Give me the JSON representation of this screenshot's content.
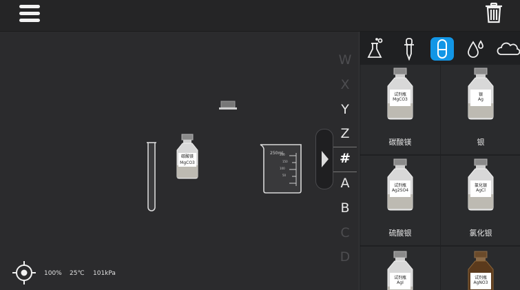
{
  "toolbar": {
    "menu_icon": "hamburger-menu-icon",
    "trash_icon": "trash-icon"
  },
  "tabs": [
    {
      "icon": "flask-icon",
      "active": false
    },
    {
      "icon": "dropper-icon",
      "active": false
    },
    {
      "icon": "capsule-icon",
      "active": true
    },
    {
      "icon": "droplet-icon",
      "active": false
    },
    {
      "icon": "cloud-icon",
      "active": false
    }
  ],
  "alphabet": [
    "W",
    "X",
    "Y",
    "Z",
    "#",
    "A",
    "B",
    "C",
    "D"
  ],
  "reagents": [
    {
      "name": "碳酸镁",
      "tag_line1": "试剂瓶",
      "tag_line2": "MgCO3"
    },
    {
      "name": "银",
      "tag_line1": "银",
      "tag_line2": "Ag"
    },
    {
      "name": "硫酸银",
      "tag_line1": "试剂瓶",
      "tag_line2": "Ag2SO4"
    },
    {
      "name": "氯化银",
      "tag_line1": "氯化银",
      "tag_line2": "AgCl"
    },
    {
      "name": "",
      "tag_line1": "试剂瓶",
      "tag_line2": "AgI"
    },
    {
      "name": "",
      "tag_line1": "试剂瓶",
      "tag_line2": "AgNO3"
    }
  ],
  "bench": {
    "bottle_tag_line1": "碳酸镁",
    "bottle_tag_line2": "MgCO3",
    "beaker_volume": "250mL",
    "beaker_marks": [
      "200",
      "150",
      "100",
      "50"
    ]
  },
  "status": {
    "humidity": "100%",
    "temperature": "25℃",
    "pressure": "101kPa"
  },
  "colors": {
    "accent": "#1296e6",
    "panel": "#1f2022",
    "workspace": "#2b2b2d"
  }
}
